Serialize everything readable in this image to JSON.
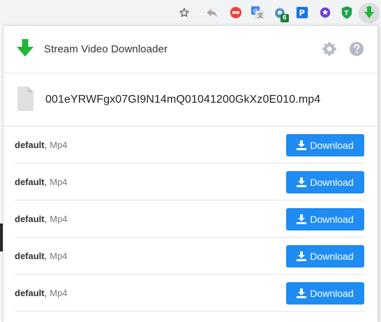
{
  "popup": {
    "title": "Stream Video Downloader",
    "filename": "001eYRWFgx07GI9N14mQ01041200GkXz0E010.mp4",
    "rows": [
      {
        "quality": "default",
        "separator": ",",
        "format": "Mp4",
        "button_label": "Download"
      },
      {
        "quality": "default",
        "separator": ",",
        "format": "Mp4",
        "button_label": "Download"
      },
      {
        "quality": "default",
        "separator": ",",
        "format": "Mp4",
        "button_label": "Download"
      },
      {
        "quality": "default",
        "separator": ",",
        "format": "Mp4",
        "button_label": "Download"
      },
      {
        "quality": "default",
        "separator": ",",
        "format": "Mp4",
        "button_label": "Download"
      }
    ]
  },
  "toolbar": {
    "extension_badge_count": "6",
    "icons": [
      "bookmark-star-icon",
      "back-arrow-icon",
      "infinity-extension-icon",
      "translate-extension-icon",
      "gear-extension-icon",
      "p-extension-icon",
      "star-extension-icon",
      "shield-extension-icon",
      "stream-downloader-extension-icon"
    ]
  },
  "colors": {
    "accent": "#1e8cf2",
    "logo_green": "#22b33a",
    "header_icons": "#b6b9c8"
  }
}
